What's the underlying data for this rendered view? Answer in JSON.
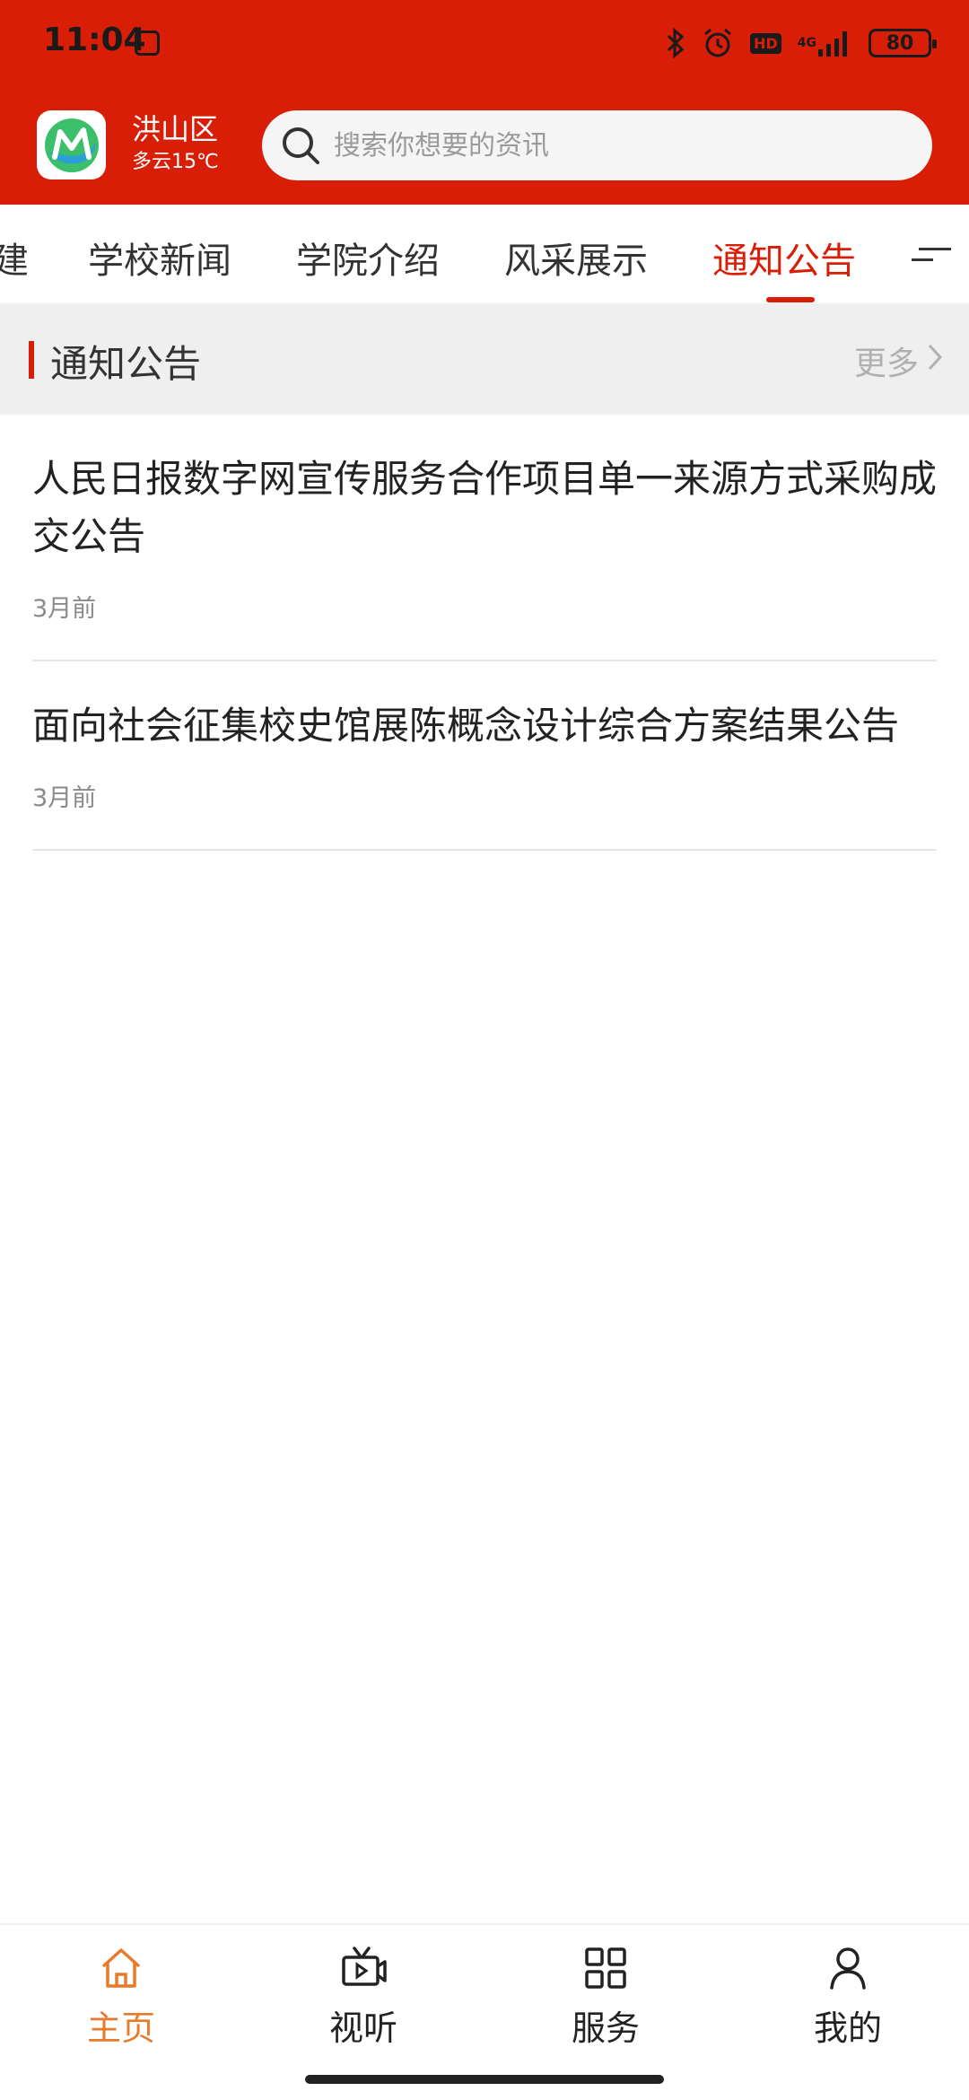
{
  "status_bar": {
    "time": "11:04",
    "network": "4G",
    "hd_badge": "HD",
    "battery": "80"
  },
  "header": {
    "city": "洪山区",
    "weather": "多云15℃",
    "search_placeholder": "搜索你想要的资讯",
    "brand_color": "#d81e06"
  },
  "tabs": [
    {
      "label": "建",
      "active": false
    },
    {
      "label": "学校新闻",
      "active": false
    },
    {
      "label": "学院介绍",
      "active": false
    },
    {
      "label": "风采展示",
      "active": false
    },
    {
      "label": "通知公告",
      "active": true
    }
  ],
  "section": {
    "title": "通知公告",
    "more_label": "更多"
  },
  "list": [
    {
      "title": "人民日报数字网宣传服务合作项目单一来源方式采购成交公告",
      "time": "3月前"
    },
    {
      "title": "面向社会征集校史馆展陈概念设计综合方案结果公告",
      "time": "3月前"
    }
  ],
  "nav": [
    {
      "label": "主页",
      "icon": "home-icon",
      "active": true
    },
    {
      "label": "视听",
      "icon": "tv-icon",
      "active": false
    },
    {
      "label": "服务",
      "icon": "grid-icon",
      "active": false
    },
    {
      "label": "我的",
      "icon": "user-icon",
      "active": false
    }
  ],
  "colors": {
    "accent": "#d81e06",
    "nav_active": "#e87a2c"
  }
}
